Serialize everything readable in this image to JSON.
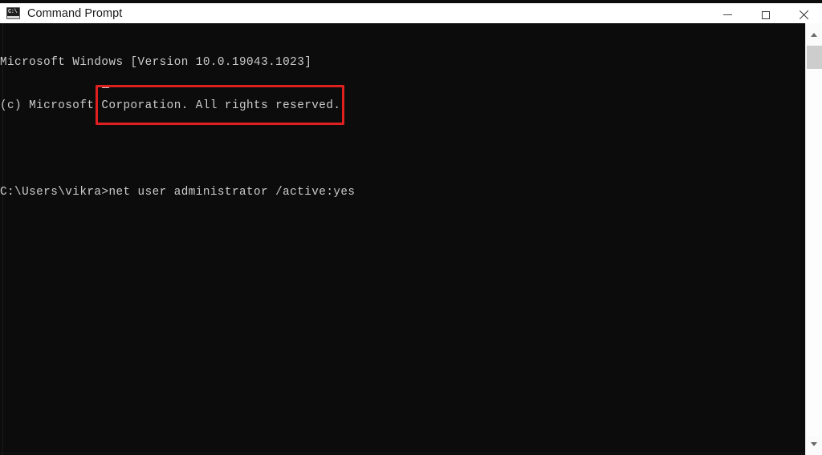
{
  "window": {
    "title": "Command Prompt",
    "icon": "command-prompt-icon",
    "icon_glyph": "C:\\",
    "background_color": "#0c0c0c",
    "titlebar_color": "#ffffff"
  },
  "window_controls": {
    "minimize": {
      "name": "minimize-button",
      "glyph": "—"
    },
    "maximize": {
      "name": "maximize-button",
      "glyph": "□"
    },
    "close": {
      "name": "close-button",
      "glyph": "✕"
    }
  },
  "console": {
    "lines": [
      "Microsoft Windows [Version 10.0.19043.1023]",
      "(c) Microsoft Corporation. All rights reserved.",
      "",
      "C:\\Users\\vikra>net user administrator /active:yes"
    ],
    "prompt": "C:\\Users\\vikra>",
    "command": "net user administrator /active:yes",
    "version_line": "Microsoft Windows [Version 10.0.19043.1023]",
    "copyright_line": "(c) Microsoft Corporation. All rights reserved.",
    "text_color": "#cccccc",
    "cursor": "_"
  },
  "annotation": {
    "type": "rectangle-highlight",
    "color": "#e02020",
    "targets": "net user administrator /active:yes"
  },
  "scrollbar": {
    "up_arrow": "▲",
    "down_arrow": "▼",
    "thumb_position": "near-top"
  }
}
